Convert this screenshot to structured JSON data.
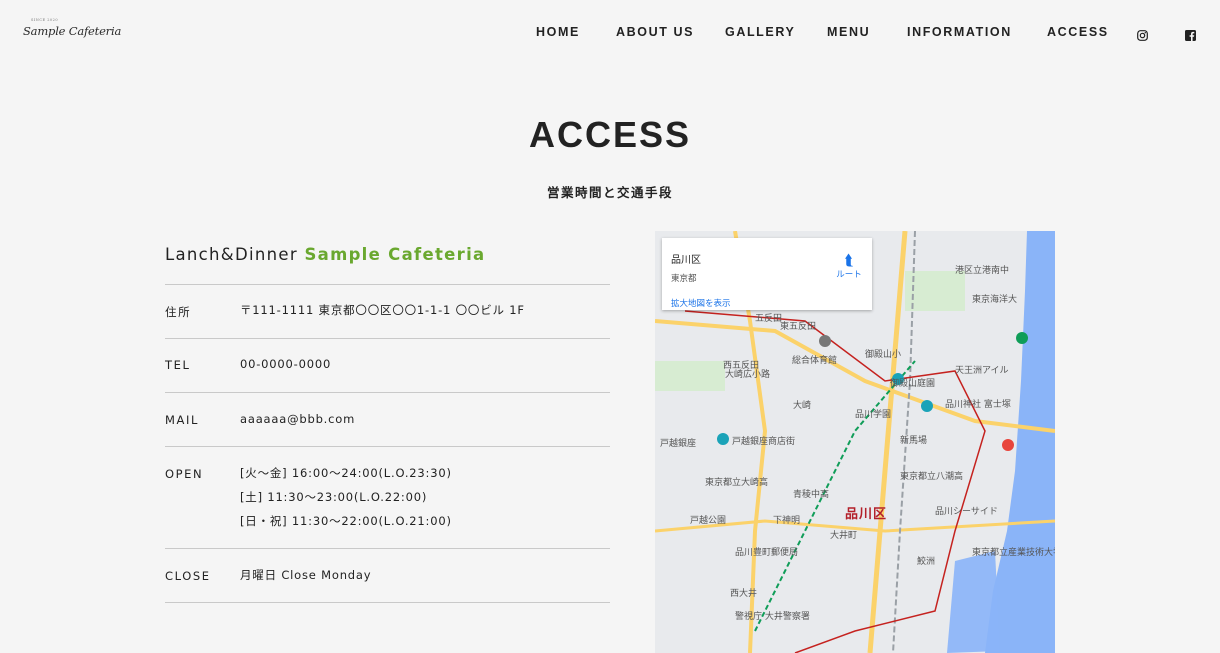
{
  "header": {
    "logo": "Sample Cafeteria",
    "logo_small": "SINCE 2020",
    "nav": [
      "HOME",
      "ABOUT US",
      "GALLERY",
      "MENU",
      "INFORMATION",
      "ACCESS"
    ],
    "icons": [
      "instagram-icon",
      "facebook-icon"
    ]
  },
  "page": {
    "title": "ACCESS",
    "subtitle": "営業時間と交通手段"
  },
  "info": {
    "heading_prefix": "Lanch&Dinner",
    "heading_name": "Sample Cafeteria",
    "rows": [
      {
        "label": "住所",
        "lines": [
          "〒111-1111 東京都〇〇区〇〇1-1-1 〇〇ビル 1F"
        ]
      },
      {
        "label": "TEL",
        "lines": [
          "00-0000-0000"
        ]
      },
      {
        "label": "MAIL",
        "lines": [
          "aaaaaa@bbb.com"
        ]
      },
      {
        "label": "OPEN",
        "lines": [
          "[火〜金] 16:00〜24:00(L.O.23:30)",
          "[土] 11:30〜23:00(L.O.22:00)",
          "[日・祝] 11:30〜22:00(L.O.21:00)"
        ]
      },
      {
        "label": "CLOSE",
        "lines": [
          "月曜日 Close Monday"
        ]
      }
    ]
  },
  "map": {
    "place": "品川区",
    "pref": "東京都",
    "enlarge": "拡大地図を表示",
    "route": "ルート",
    "area_label": "品川区",
    "labels": [
      "五反田",
      "大崎",
      "戸越銀座",
      "品川学園",
      "御殿山庭園",
      "新馬場",
      "大井町",
      "鮫洲",
      "東京都立八潮高",
      "品川シーサイド",
      "港区立港南中",
      "東京海洋大",
      "西大井",
      "戸越公園",
      "品川豊町郵便局",
      "警視庁 大井警察署",
      "東京都立産業技術大学院大",
      "総合体育館",
      "大崎広小路",
      "戸越銀座商店街",
      "東京都立大崎高",
      "青稜中高",
      "下神明",
      "御殿山小",
      "品川神社 富士塚",
      "天王洲アイル",
      "東五反田",
      "西五反田"
    ],
    "colors": {
      "water": "#8ab4f8",
      "road_major": "#fbd26a",
      "rail": "#9aa0a6",
      "border": "#c5221f",
      "park": "#c8e6c9"
    }
  }
}
